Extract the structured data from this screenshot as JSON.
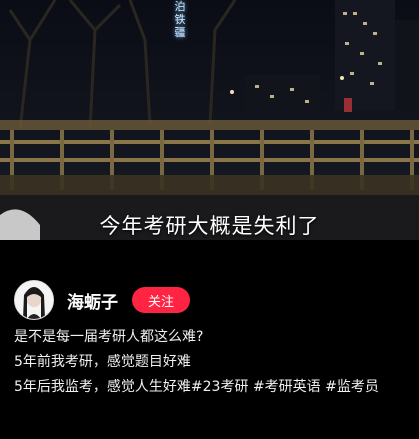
{
  "video": {
    "sign_text": "泊铁疆",
    "subtitle": "今年考研大概是失利了"
  },
  "author": {
    "name": "海蛎子",
    "follow_label": "关注"
  },
  "caption": {
    "line1": "是不是每一届考研人都这么难?",
    "line2": "5年前我考研，感觉题目好难",
    "line3_text": "5年后我监考，感觉人生好难",
    "tags": [
      "#23考研",
      "#考研英语",
      "#监考员"
    ]
  },
  "colors": {
    "accent": "#ff2442",
    "background": "#000000"
  }
}
